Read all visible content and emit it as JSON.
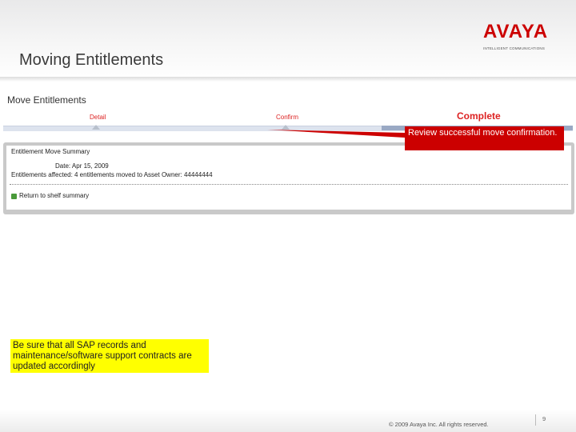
{
  "slide": {
    "title": "Moving Entitlements",
    "logo_text": "AVAYA",
    "logo_tagline": "INTELLIGENT COMMUNICATIONS"
  },
  "app": {
    "page_heading": "Move Entitlements",
    "steps": [
      {
        "label": "Detail"
      },
      {
        "label": "Confirm"
      },
      {
        "label": "Complete",
        "current": true
      }
    ],
    "summary": {
      "heading": "Entitlement Move Summary",
      "date_label": "Date: Apr 15, 2009",
      "result_text": "Entitlements affected: 4 entitlements moved to Asset Owner: 44444444",
      "return_link": "Return to shelf summary"
    }
  },
  "callout": {
    "text": "Review successful move confirmation."
  },
  "note": {
    "text": "Be sure that all SAP records and maintenance/software support contracts are updated accordingly"
  },
  "footer": {
    "copyright": "© 2009 Avaya Inc. All rights reserved.",
    "page_number": "9"
  },
  "colors": {
    "brand": "#cc0000",
    "callout": "#cc0000",
    "note": "#ffff00",
    "success_icon": "#4a9a3a"
  },
  "icons": {
    "return": "return-arrow-icon"
  }
}
